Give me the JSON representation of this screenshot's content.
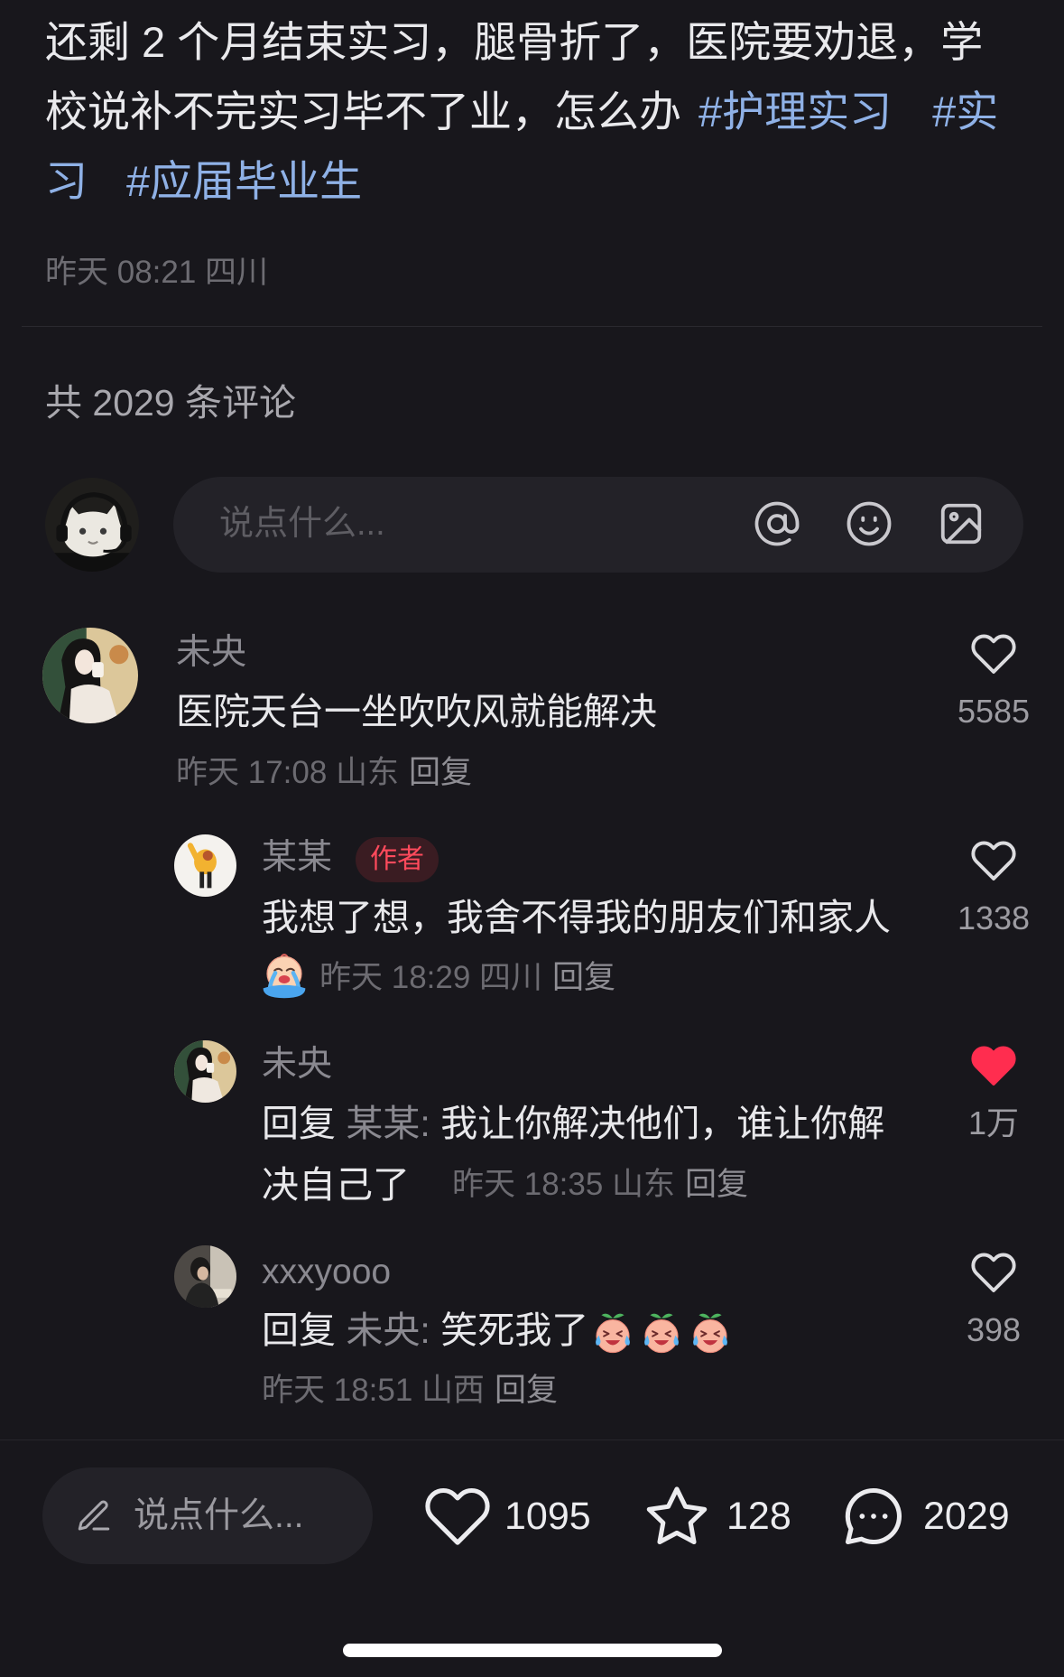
{
  "post": {
    "line1": "还剩 2 个月结束实习，腿骨折了，医院要劝退，学",
    "line2": "校说补不完实习毕不了业，怎么办",
    "tags": [
      "#护理实习",
      "#实",
      "习",
      "#应届毕业生"
    ],
    "time_location": "昨天 08:21 四川"
  },
  "comments_header": "共 2029 条评论",
  "comment_input": {
    "placeholder": "说点什么...",
    "icons": [
      "at-icon",
      "smile-icon",
      "image-icon"
    ]
  },
  "comments": [
    {
      "user": "未央",
      "text": "医院天台一坐吹吹风就能解决",
      "meta": "昨天 17:08 山东",
      "reply_label": "回复",
      "likes": "5585",
      "liked": false,
      "replies": [
        {
          "user": "某某",
          "badge": "作者",
          "text": "我想了想，我舍不得我的朋友们和家人",
          "emoji": "crying-flood-emoji",
          "meta": "昨天 18:29 四川",
          "reply_label": "回复",
          "likes": "1338",
          "liked": false
        },
        {
          "user": "未央",
          "reply_prefix": "回复",
          "reply_to": "某某:",
          "text_line1": "我让你解决他们，谁让你解",
          "text_line2": "决自己了",
          "meta": "昨天 18:35 山东",
          "reply_label": "回复",
          "likes": "1万",
          "liked": true
        },
        {
          "user": "xxxyooo",
          "reply_prefix": "回复",
          "reply_to": "未央:",
          "text": "笑死我了",
          "emojis": [
            "laugh-cry-emoji",
            "laugh-cry-emoji",
            "laugh-cry-emoji"
          ],
          "meta": "昨天 18:51 山西",
          "reply_label": "回复",
          "likes": "398",
          "liked": false
        }
      ]
    }
  ],
  "bottom_bar": {
    "placeholder": "说点什么...",
    "likes": "1095",
    "collects": "128",
    "comments": "2029",
    "icons": [
      "pencil-icon",
      "heart-icon",
      "star-icon",
      "comment-icon"
    ]
  },
  "colors": {
    "background": "#18171c",
    "text": "#e8e8eb",
    "secondary": "#8a8990",
    "hashtag": "#8fb1e6",
    "like_active": "#ff2d4f",
    "author_badge": "#ff4a5c"
  }
}
